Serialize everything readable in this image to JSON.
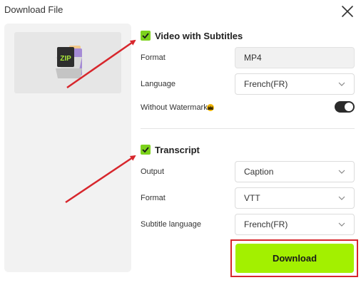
{
  "dialog": {
    "title": "Download File"
  },
  "thumbnail": {
    "badge": "ZIP"
  },
  "video": {
    "checked": true,
    "title": "Video with Subtitles",
    "format_label": "Format",
    "format_value": "MP4",
    "language_label": "Language",
    "language_value": "French(FR)",
    "watermark_label": "Without Watermark",
    "watermark_enabled": true
  },
  "transcript": {
    "checked": true,
    "title": "Transcript",
    "output_label": "Output",
    "output_value": "Caption",
    "format_label": "Format",
    "format_value": "VTT",
    "subtitle_language_label": "Subtitle language",
    "subtitle_language_value": "French(FR)"
  },
  "actions": {
    "download_label": "Download"
  },
  "colors": {
    "accent": "#a3f000",
    "checkbox": "#7cd21c",
    "highlight": "#d7262c",
    "premium": "#f0b400"
  }
}
